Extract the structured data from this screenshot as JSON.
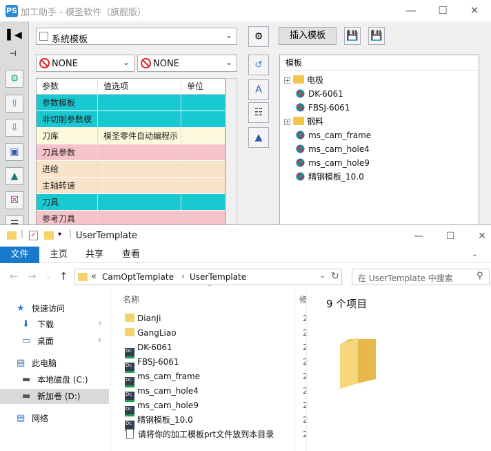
{
  "top_window": {
    "title": "加工助手 - 模圣软件（旗舰版）",
    "app_icon": "PS",
    "template_select": "系統模板",
    "combo_left": "NONE",
    "combo_right": "NONE",
    "grid": {
      "headers": [
        "参数",
        "值选项",
        "单位"
      ],
      "rows": [
        {
          "param": "参数模板",
          "value": "",
          "color": "#19c9d2"
        },
        {
          "param": "非切削参数模",
          "value": "",
          "color": "#19c9d2"
        },
        {
          "param": "刀库",
          "value": "模圣零件自动编程示",
          "color": "#fbf8dc"
        },
        {
          "param": "刀具参数",
          "value": "",
          "color": "#f6c3cb"
        },
        {
          "param": "进给",
          "value": "",
          "color": "#f9e3c9"
        },
        {
          "param": "主轴转速",
          "value": "",
          "color": "#f9e3c9"
        },
        {
          "param": "刀具",
          "value": "",
          "color": "#19c9d2"
        },
        {
          "param": "参考刀具",
          "value": "",
          "color": "#f6c3cb"
        }
      ]
    },
    "insert_button": "插入模板",
    "template_panel": {
      "header": "模板",
      "tree": [
        {
          "label": "电极",
          "type": "folder",
          "level": 0
        },
        {
          "label": "DK-6061",
          "type": "file",
          "level": 1
        },
        {
          "label": "FBSJ-6061",
          "type": "file",
          "level": 1
        },
        {
          "label": "钢料",
          "type": "folder",
          "level": 0
        },
        {
          "label": "ms_cam_frame",
          "type": "file",
          "level": 1
        },
        {
          "label": "ms_cam_hole4",
          "type": "file",
          "level": 1
        },
        {
          "label": "ms_cam_hole9",
          "type": "file",
          "level": 1
        },
        {
          "label": "精钢模板_10.0",
          "type": "file",
          "level": 1
        }
      ]
    }
  },
  "explorer": {
    "title": "UserTemplate",
    "ribbon_tabs": [
      "文件",
      "主页",
      "共享",
      "查看"
    ],
    "address": {
      "prefix": "«",
      "parts": [
        "CamOptTemplate",
        "UserTemplate"
      ]
    },
    "search_placeholder": "在 UserTemplate 中搜索",
    "nav": [
      {
        "label": "快速访问",
        "icon": "star-icon"
      },
      {
        "label": "下载",
        "icon": "download-icon"
      },
      {
        "label": "桌面",
        "icon": "desktop-icon"
      },
      {
        "label": "此电脑",
        "icon": "computer-icon"
      },
      {
        "label": "本地磁盘 (C:)",
        "icon": "drive-icon"
      },
      {
        "label": "新加卷 (D:)",
        "icon": "drive-icon"
      },
      {
        "label": "网络",
        "icon": "network-icon"
      }
    ],
    "column_header": "名称",
    "column_header2": "修",
    "files": [
      {
        "name": "DianJi",
        "type": "folder",
        "date": "2"
      },
      {
        "name": "GangLiao",
        "type": "folder",
        "date": "2"
      },
      {
        "name": "DK-6061",
        "type": "dc",
        "date": "2"
      },
      {
        "name": "FBSJ-6061",
        "type": "dc",
        "date": "2"
      },
      {
        "name": "ms_cam_frame",
        "type": "dc",
        "date": "2"
      },
      {
        "name": "ms_cam_hole4",
        "type": "dc",
        "date": "2"
      },
      {
        "name": "ms_cam_hole9",
        "type": "dc",
        "date": "2"
      },
      {
        "name": "精钢模板_10.0",
        "type": "dc",
        "date": "2"
      },
      {
        "name": "请将你的加工模板prt文件放到本目录",
        "type": "txt",
        "date": "2"
      }
    ],
    "item_count": "9 个项目"
  }
}
